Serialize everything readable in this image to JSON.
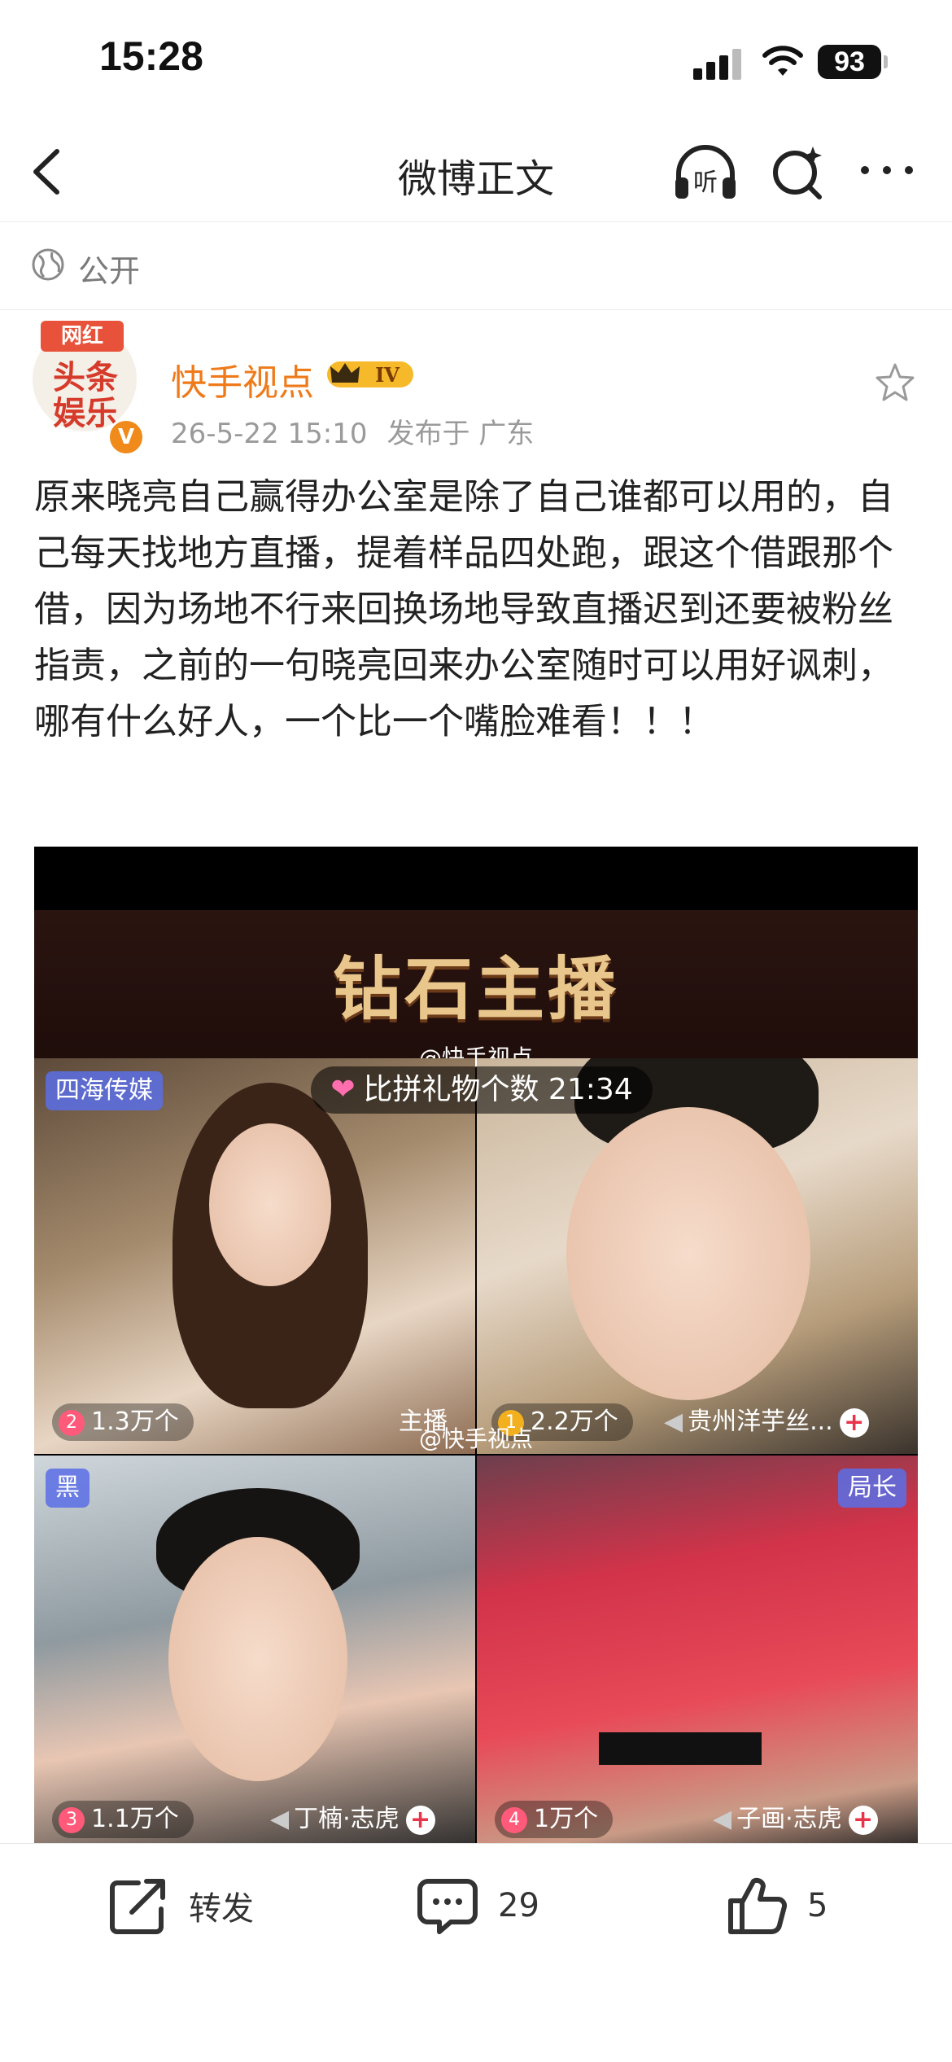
{
  "status_bar": {
    "time": "15:28",
    "battery": "93"
  },
  "nav": {
    "title": "微博正文"
  },
  "privacy": {
    "label": "公开"
  },
  "author": {
    "avatar_ribbon": "网红",
    "avatar_text": "头条娱乐",
    "name": "快手视点",
    "level_badge": "IV",
    "date": "26-5-22 15:10",
    "location": "发布于 广东"
  },
  "post": {
    "text": "原来晓亮自己赢得办公室是除了自己谁都可以用的，自己每天找地方直播，提着样品四处跑，跟这个借跟那个借，因为场地不行来回换场地导致直播迟到还要被粉丝指责，之前的一句晓亮回来办公室随时可以用好讽刺，哪有什么好人，一个比一个嘴脸难看！！！"
  },
  "media": {
    "banner_title": "钻石主播",
    "watermark": "@快手视点",
    "watermark_mid": "@快手视点",
    "pk_label": "比拼礼物个数 21:34",
    "cells": [
      {
        "tag": "四海传媒",
        "rank": "2",
        "score": "1.3万个",
        "label": "主播"
      },
      {
        "tag": "",
        "rank": "1",
        "score": "2.2万个",
        "label": "贵州洋芋丝..."
      },
      {
        "tag": "黑",
        "rank": "3",
        "score": "1.1万个",
        "label": "丁楠·志虎"
      },
      {
        "tag": "局长",
        "rank": "4",
        "score": "1万个",
        "label": "子画·志虎"
      }
    ],
    "plus": "+"
  },
  "actions": {
    "repost_label": "转发",
    "comment_count": "29",
    "like_count": "5"
  }
}
